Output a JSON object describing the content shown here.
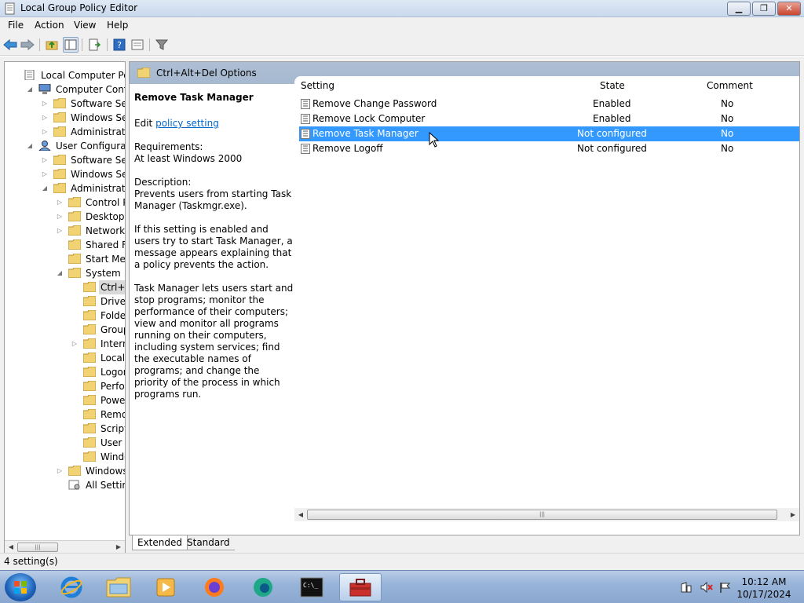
{
  "window": {
    "title": "Local Group Policy Editor",
    "minimize_label": "▁",
    "maximize_label": "❐",
    "close_label": "✕"
  },
  "menubar": {
    "items": [
      "File",
      "Action",
      "View",
      "Help"
    ]
  },
  "tree": {
    "items": [
      {
        "label": "Local Computer Policy"
      },
      {
        "label": "Computer Configura"
      },
      {
        "label": "Software Settings"
      },
      {
        "label": "Windows Setting:"
      },
      {
        "label": "Administrative Te"
      },
      {
        "label": "User Configuration"
      },
      {
        "label": "Software Settings"
      },
      {
        "label": "Windows Setting:"
      },
      {
        "label": "Administrative Te"
      },
      {
        "label": "Control Panel"
      },
      {
        "label": "Desktop"
      },
      {
        "label": "Network"
      },
      {
        "label": "Shared Folder"
      },
      {
        "label": "Start Menu ar"
      },
      {
        "label": "System"
      },
      {
        "label": "Ctrl+Alt+I"
      },
      {
        "label": "Driver Inst"
      },
      {
        "label": "Folder Rec"
      },
      {
        "label": "Group Pol"
      },
      {
        "label": "Internet C"
      },
      {
        "label": "Locale Ser"
      },
      {
        "label": "Logon"
      },
      {
        "label": "Performar"
      },
      {
        "label": "Power Ma"
      },
      {
        "label": "Removabl"
      },
      {
        "label": "Scripts"
      },
      {
        "label": "User Profi"
      },
      {
        "label": "Windows"
      },
      {
        "label": "Windows Cor"
      },
      {
        "label": "All Settings"
      }
    ],
    "scroll_grip": "|||"
  },
  "pane": {
    "header": "Ctrl+Alt+Del Options",
    "description": {
      "title": "Remove Task Manager",
      "edit_prefix": "Edit",
      "edit_link": "policy setting",
      "requirements_label": "Requirements:",
      "requirements_value": "At least Windows 2000",
      "paragraphs": [
        "Description:\nPrevents users from starting Task Manager (Taskmgr.exe).",
        "If this setting is enabled and users try to start Task Manager, a message appears explaining that a policy prevents the action.",
        "Task Manager lets users start and stop programs; monitor the performance of their computers; view and monitor all programs running on their computers, including system services; find the executable names of programs; and change the priority of the process in which programs run."
      ]
    },
    "columns": {
      "setting": "Setting",
      "state": "State",
      "comment": "Comment"
    },
    "rows": [
      {
        "setting": "Remove Change Password",
        "state": "Enabled",
        "comment": "No"
      },
      {
        "setting": "Remove Lock Computer",
        "state": "Enabled",
        "comment": "No"
      },
      {
        "setting": "Remove Task Manager",
        "state": "Not configured",
        "comment": "No"
      },
      {
        "setting": "Remove Logoff",
        "state": "Not configured",
        "comment": "No"
      }
    ],
    "scroll_grip": "|||"
  },
  "tabs": {
    "extended": "Extended",
    "standard": "Standard"
  },
  "statusbar": {
    "text": "4 setting(s)"
  },
  "taskbar": {
    "time": "10:12 AM",
    "date": "10/17/2024",
    "cmd_prompt": "C:\\_"
  },
  "colors": {
    "selection": "#3399ff",
    "header_band": "#a6b9d0",
    "link": "#0066cc"
  }
}
